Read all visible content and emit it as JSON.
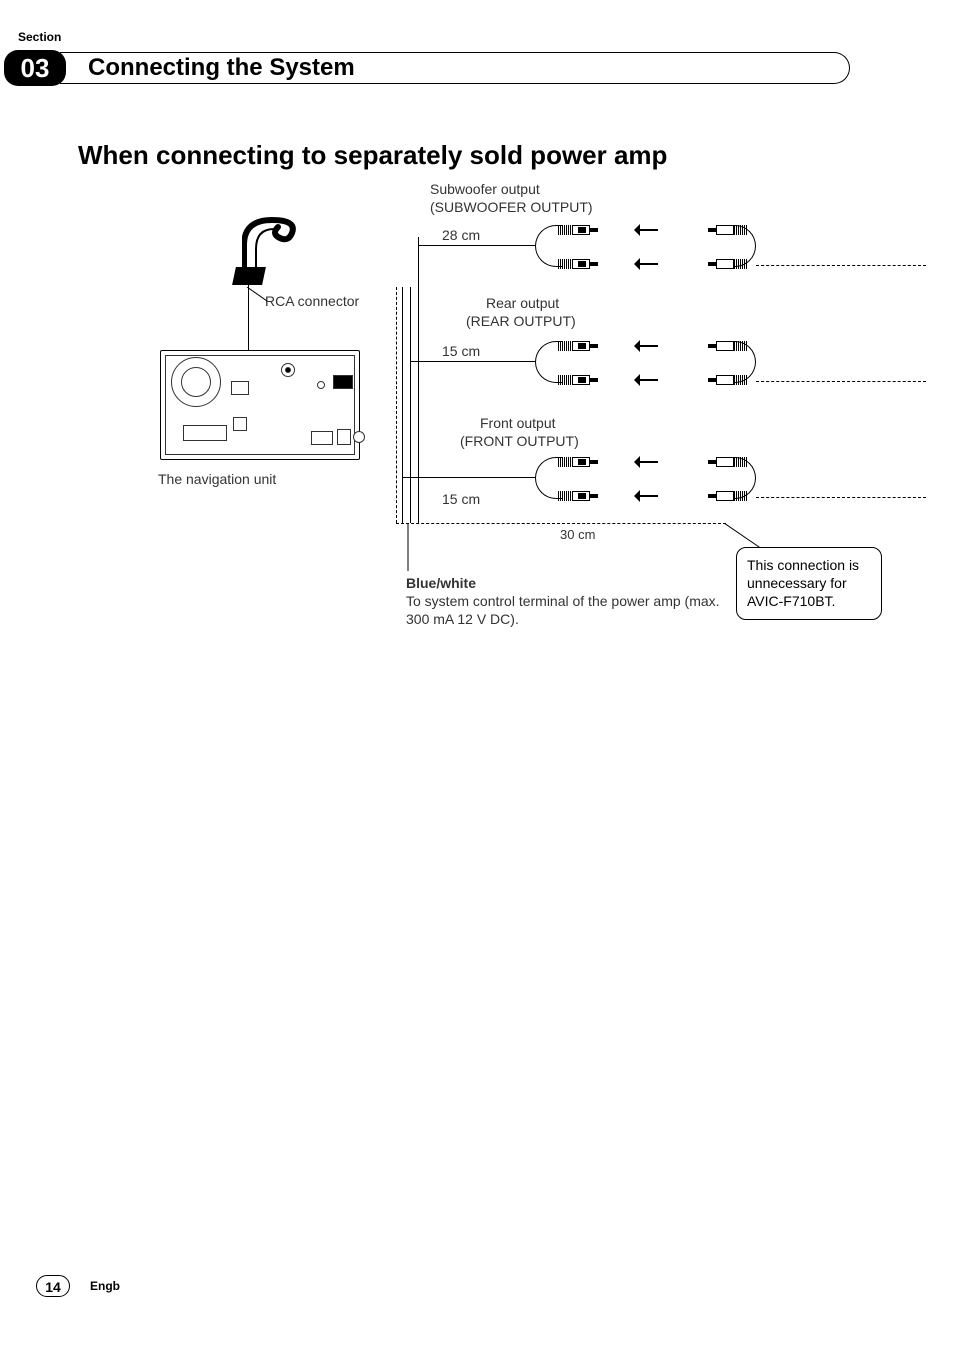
{
  "header": {
    "section_label": "Section",
    "section_number": "03",
    "section_title": "Connecting the System"
  },
  "heading": "When connecting to separately sold power amp",
  "diagram": {
    "rca_connector_label": "RCA connector",
    "nav_unit_label": "The navigation unit",
    "outputs": {
      "subwoofer": {
        "title": "Subwoofer output",
        "subtitle": "(SUBWOOFER OUTPUT)",
        "length": "28 cm"
      },
      "rear": {
        "title": "Rear output",
        "subtitle": "(REAR OUTPUT)",
        "length": "15 cm"
      },
      "front": {
        "title": "Front output",
        "subtitle": "(FRONT OUTPUT)",
        "length": "15 cm"
      }
    },
    "bottom_length": "30 cm",
    "blue_white": {
      "label": "Blue/white",
      "desc": "To system control terminal of the power amp (max. 300 mA 12 V DC)."
    },
    "callout": "This connection is unnecessary for AVIC-F710BT."
  },
  "footer": {
    "page": "14",
    "lang": "Engb"
  }
}
